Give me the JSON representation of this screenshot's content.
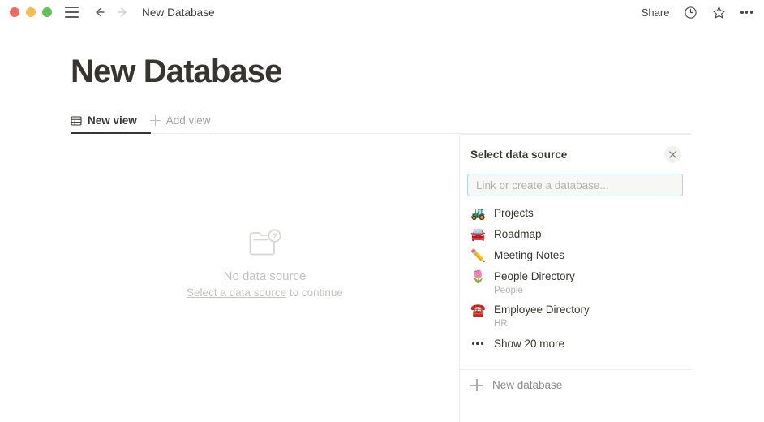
{
  "window": {
    "traffic_lights": [
      {
        "name": "close",
        "color": "#ED6A5E"
      },
      {
        "name": "minimize",
        "color": "#F4BD4F"
      },
      {
        "name": "maximize",
        "color": "#61C454"
      }
    ],
    "breadcrumb": "New Database",
    "menu_icon": "hamburger-icon",
    "back_icon": "back-arrow-icon",
    "forward_icon": "forward-arrow-icon"
  },
  "topbar": {
    "share_label": "Share",
    "history_icon": "clock-icon",
    "favorite_icon": "star-icon",
    "more_icon": "ellipsis-icon"
  },
  "page": {
    "title": "New Database"
  },
  "tabs": [
    {
      "label": "New view",
      "icon": "table-view-icon",
      "active": true
    },
    {
      "label": "Add view",
      "icon": "plus-icon",
      "active": false
    }
  ],
  "empty_state": {
    "icon": "folder-question-icon",
    "title": "No data source",
    "link_text": "Select a data source",
    "suffix_text": " to continue"
  },
  "panel": {
    "heading": "Select data source",
    "close_icon": "close-icon",
    "search": {
      "placeholder": "Link or create a database...",
      "value": "",
      "border_color": "#a9d5ef"
    },
    "items": [
      {
        "emoji": "🚜",
        "icon_name": "tractor-emoji",
        "name": "Projects",
        "sub": ""
      },
      {
        "emoji": "🚘",
        "icon_name": "car-emoji",
        "name": "Roadmap",
        "sub": ""
      },
      {
        "emoji": "✏️",
        "icon_name": "pencil-emoji",
        "name": "Meeting Notes",
        "sub": ""
      },
      {
        "emoji": "🌷",
        "icon_name": "tulip-emoji",
        "name": "People Directory",
        "sub": "People"
      },
      {
        "emoji": "☎️",
        "icon_name": "telephone-emoji",
        "name": "Employee Directory",
        "sub": "HR"
      }
    ],
    "show_more": {
      "label": "Show 20 more",
      "icon": "ellipsis-icon"
    },
    "new_database": {
      "label": "New database",
      "icon": "plus-icon"
    }
  }
}
